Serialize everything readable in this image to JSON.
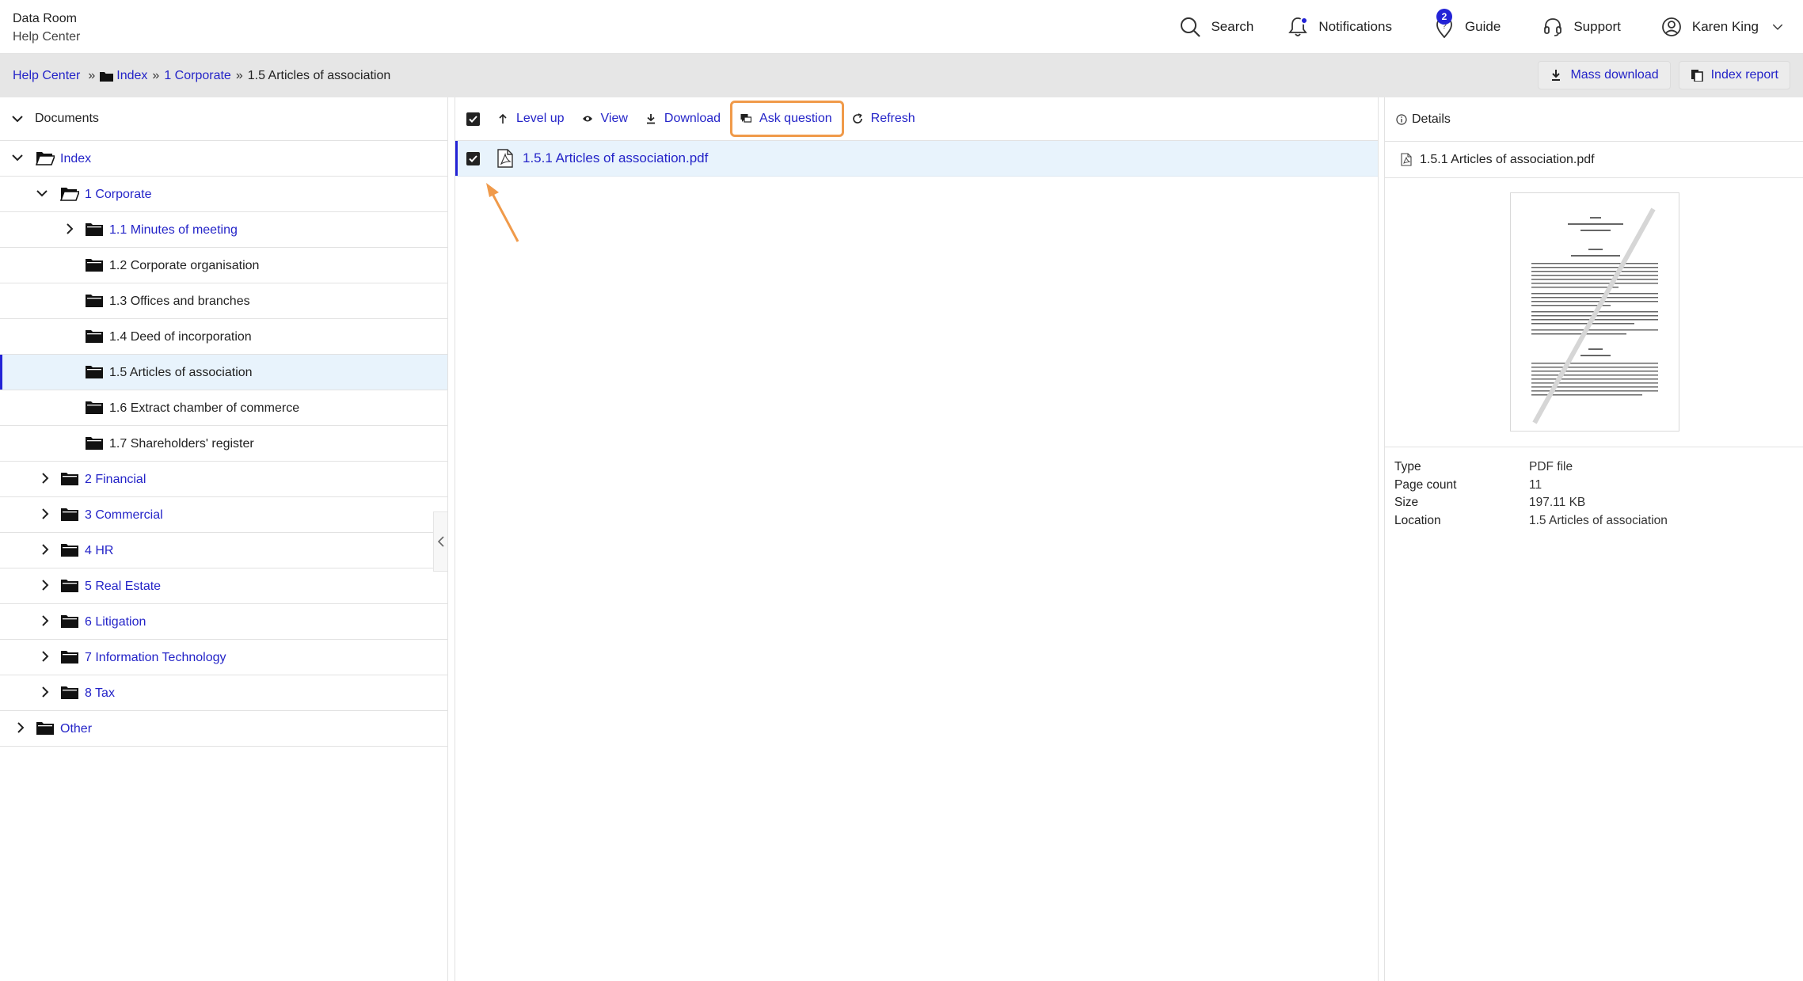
{
  "header": {
    "brand_title": "Data Room",
    "brand_subtitle": "Help Center",
    "nav": {
      "search": "Search",
      "notifications": "Notifications",
      "guide": "Guide",
      "guide_badge": "2",
      "support": "Support",
      "user": "Karen King"
    }
  },
  "breadcrumb": {
    "items": [
      "Help Center",
      "Index",
      "1 Corporate",
      "1.5 Articles of association"
    ],
    "separator": "»"
  },
  "actions": {
    "mass_download": "Mass download",
    "index_report": "Index report"
  },
  "tree": {
    "title": "Documents",
    "rows": [
      {
        "label": "Index",
        "state": "expanded",
        "link": true
      },
      {
        "label": "1 Corporate",
        "state": "expanded",
        "link": true
      },
      {
        "label": "1.1 Minutes of meeting",
        "state": "collapsed",
        "link": true
      },
      {
        "label": "1.2 Corporate organisation",
        "state": "leaf",
        "link": false
      },
      {
        "label": "1.3 Offices and branches",
        "state": "leaf",
        "link": false
      },
      {
        "label": "1.4 Deed of incorporation",
        "state": "leaf",
        "link": false
      },
      {
        "label": "1.5 Articles of association",
        "state": "leaf",
        "link": false,
        "selected": true
      },
      {
        "label": "1.6 Extract chamber of commerce",
        "state": "leaf",
        "link": false
      },
      {
        "label": "1.7 Shareholders' register",
        "state": "leaf",
        "link": false
      },
      {
        "label": "2 Financial",
        "state": "collapsed",
        "link": true
      },
      {
        "label": "3 Commercial",
        "state": "collapsed",
        "link": true
      },
      {
        "label": "4 HR",
        "state": "collapsed",
        "link": true
      },
      {
        "label": "5 Real Estate",
        "state": "collapsed",
        "link": true
      },
      {
        "label": "6 Litigation",
        "state": "collapsed",
        "link": true
      },
      {
        "label": "7 Information Technology",
        "state": "collapsed",
        "link": true
      },
      {
        "label": "8 Tax",
        "state": "collapsed",
        "link": true
      },
      {
        "label": "Other",
        "state": "collapsed",
        "link": true
      }
    ]
  },
  "toolbar": {
    "level_up": "Level up",
    "view": "View",
    "download": "Download",
    "ask_question": "Ask question",
    "refresh": "Refresh"
  },
  "files": [
    {
      "name": "1.5.1 Articles of association.pdf",
      "checked": true
    }
  ],
  "details": {
    "title": "Details",
    "file_name": "1.5.1 Articles of association.pdf",
    "props": [
      {
        "key": "Type",
        "value": "PDF file"
      },
      {
        "key": "Page count",
        "value": "11"
      },
      {
        "key": "Size",
        "value": "197.11 KB"
      },
      {
        "key": "Location",
        "value": "1.5 Articles of association"
      }
    ]
  },
  "colors": {
    "accent": "#2323d6",
    "link": "#2424c8",
    "highlight": "#f09a4a",
    "selected_bg": "#e8f3fc"
  }
}
